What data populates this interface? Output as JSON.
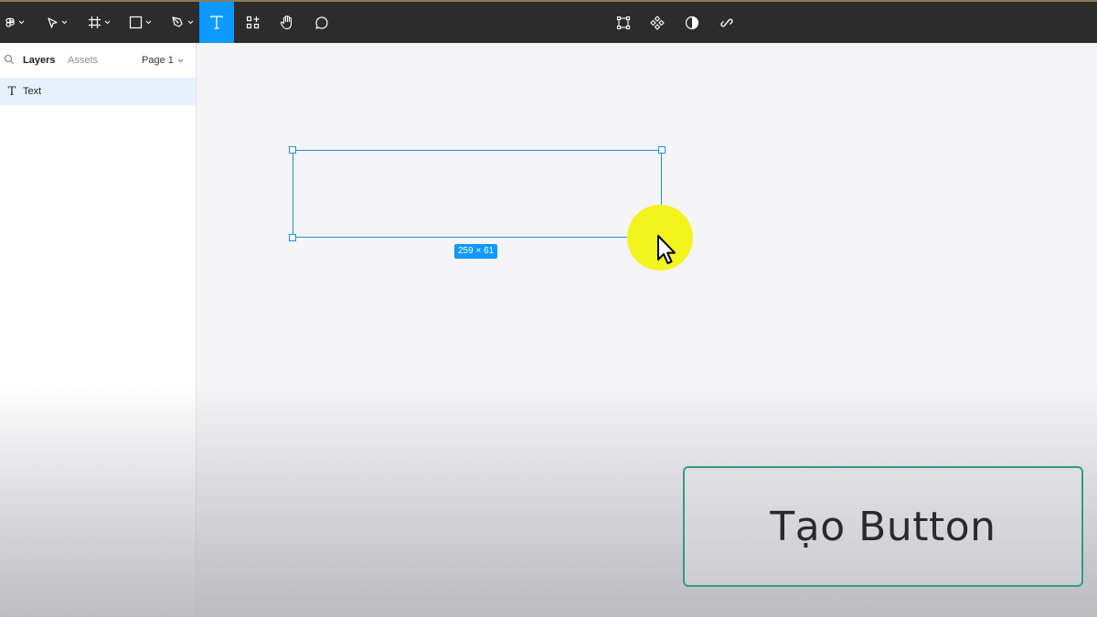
{
  "toolbar": {
    "tools": [
      {
        "name": "main-menu",
        "icon": "figma-logo-icon"
      },
      {
        "name": "move-tool",
        "icon": "pointer-icon"
      },
      {
        "name": "frame-tool",
        "icon": "frame-icon"
      },
      {
        "name": "shape-tool",
        "icon": "rectangle-icon"
      },
      {
        "name": "pen-tool",
        "icon": "pen-icon"
      },
      {
        "name": "text-tool",
        "icon": "text-icon",
        "active": true
      },
      {
        "name": "resources-tool",
        "icon": "resources-icon"
      },
      {
        "name": "hand-tool",
        "icon": "hand-icon"
      },
      {
        "name": "comment-tool",
        "icon": "comment-icon"
      }
    ],
    "center_tools": [
      {
        "name": "edit-object",
        "icon": "bounding-box-icon"
      },
      {
        "name": "component",
        "icon": "component-icon"
      },
      {
        "name": "mask",
        "icon": "contrast-icon"
      },
      {
        "name": "link",
        "icon": "link-icon"
      }
    ],
    "accent": "#0d99ff",
    "background": "#2c2c2c"
  },
  "left_panel": {
    "tabs": {
      "layers": "Layers",
      "assets": "Assets"
    },
    "page_selector": "Page 1",
    "layers": [
      {
        "label": "Text",
        "icon": "T",
        "selected": true
      }
    ]
  },
  "canvas": {
    "selection_size": "259 × 61",
    "selection_color": "#1b8fe0",
    "highlight_color": "#f3f41e"
  },
  "overlay": {
    "button_label": "Tạo Button",
    "border_color": "#2d9d8a"
  }
}
